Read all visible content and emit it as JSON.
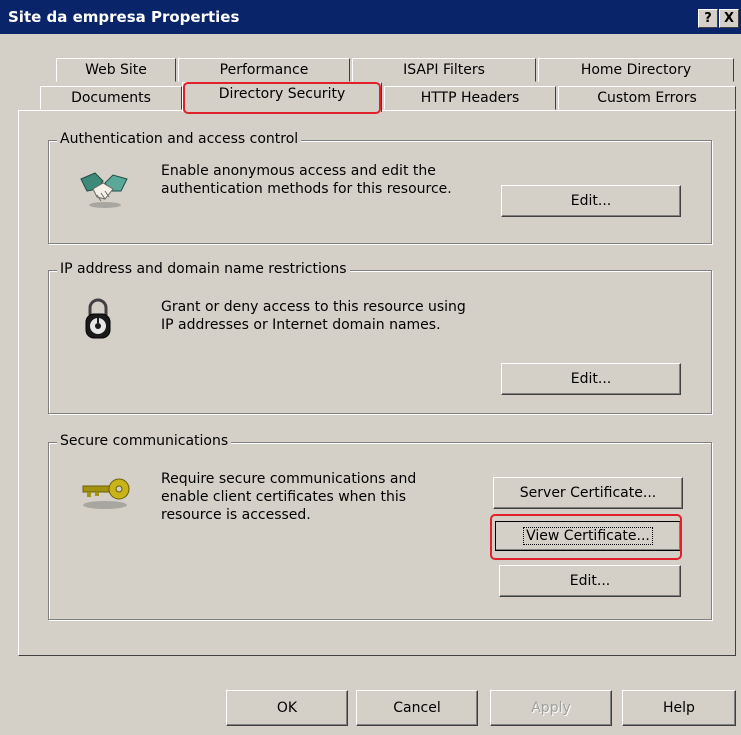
{
  "window": {
    "title": "Site da empresa Properties",
    "help_label": "?",
    "close_label": "X"
  },
  "tabs": {
    "row1": [
      "Web Site",
      "Performance",
      "ISAPI Filters",
      "Home Directory"
    ],
    "row2": [
      "Documents",
      "Directory Security",
      "HTTP Headers",
      "Custom Errors"
    ],
    "active": "Directory Security"
  },
  "auth": {
    "title": "Authentication and access control",
    "line1": "Enable anonymous access and edit the",
    "line2": "authentication methods for this resource.",
    "edit_label": "Edit...",
    "icon": "handshake-icon"
  },
  "ip": {
    "title": "IP address and domain name restrictions",
    "line1": "Grant or deny access to this resource using",
    "line2": "IP addresses or Internet domain names.",
    "edit_label": "Edit...",
    "icon": "padlock-icon"
  },
  "secure": {
    "title": "Secure communications",
    "line1": "Require secure communications and",
    "line2": "enable client certificates when this",
    "line3": "resource is accessed.",
    "server_cert_label": "Server Certificate...",
    "view_cert_label": "View Certificate...",
    "edit_label": "Edit...",
    "icon": "key-icon"
  },
  "footer": {
    "ok_label": "OK",
    "cancel_label": "Cancel",
    "apply_label": "Apply",
    "help_label": "Help"
  },
  "colors": {
    "titlebar": "#0a246a",
    "face": "#d4d0c8",
    "highlight": "#e0202a"
  }
}
